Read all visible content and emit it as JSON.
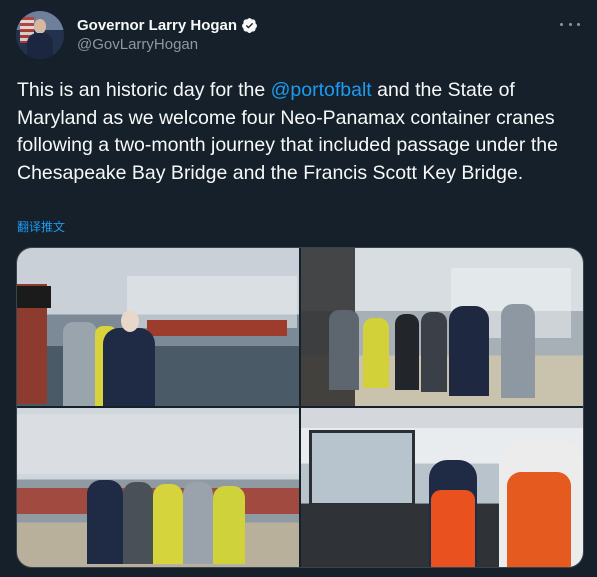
{
  "tweet": {
    "display_name": "Governor Larry Hogan",
    "handle": "@GovLarryHogan",
    "text_before": "This is an historic day for the ",
    "mention": "@portofbalt",
    "text_after": " and the State of Maryland as we welcome four Neo-Panamax container cranes following a two-month journey that included passage under the Chesapeake Bay Bridge and the Francis Scott Key Bridge.",
    "translate_label": "翻译推文"
  },
  "colors": {
    "background": "#15202b",
    "text": "#f7f9f9",
    "secondary": "#8b98a5",
    "accent": "#1d9bf0",
    "border": "#38444d"
  },
  "icons": {
    "verified": "verified-badge-icon",
    "more": "more-options-icon"
  }
}
